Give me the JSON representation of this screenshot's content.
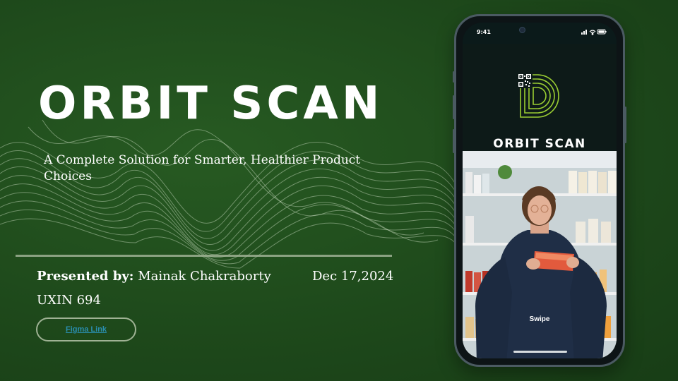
{
  "slide": {
    "title": "ORBIT SCAN",
    "subtitle": "A Complete Solution for Smarter, Healthier Product Choices",
    "presenter_label": "Presented by:",
    "presenter_name": "Mainak Chakraborty",
    "date": "Dec 17,2024",
    "course": "UXIN 694",
    "figma_link_label": "Figma Link"
  },
  "phone": {
    "time": "9:41",
    "app_name": "ORBIT SCAN",
    "swipe_label": "Swipe",
    "status_icons": [
      "signal-icon",
      "wifi-icon",
      "battery-icon"
    ],
    "logo_icon": "orbit-scan-logo-icon"
  },
  "colors": {
    "background": "#1f4a1c",
    "title": "#ffffff",
    "link": "#2a8fb0",
    "logo_accent": "#9acd32"
  }
}
